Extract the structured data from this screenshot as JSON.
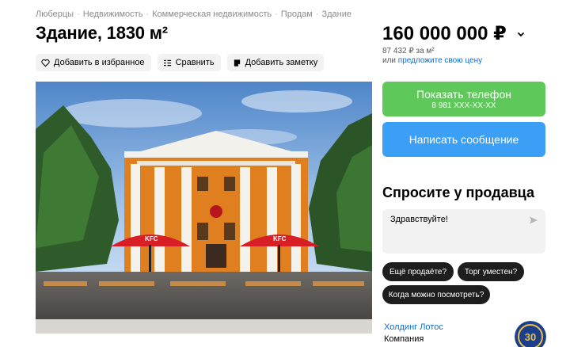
{
  "breadcrumb": {
    "items": [
      "Люберцы",
      "Недвижимость",
      "Коммерческая недвижимость",
      "Продам",
      "Здание"
    ]
  },
  "listing": {
    "title": "Здание, 1830 м²"
  },
  "actions": {
    "favorite": "Добавить в избранное",
    "compare": "Сравнить",
    "note": "Добавить заметку"
  },
  "photo": {
    "sign": "KFC"
  },
  "price": {
    "value": "160 000 000 ₽",
    "per_sqm": "87 432 ₽ за м²",
    "offer_prefix": "или",
    "offer_link": "предложите свою цену"
  },
  "contact": {
    "show_phone": "Показать телефон",
    "phone_masked": "8 981 XXX-XX-XX",
    "write_message": "Написать сообщение"
  },
  "ask": {
    "title": "Спросите у продавца",
    "message": "Здравствуйте!",
    "chips": [
      "Ещё продаёте?",
      "Торг уместен?",
      "Когда можно посмотреть?"
    ]
  },
  "seller": {
    "name": "Холдинг Лотос",
    "type": "Компания",
    "logo_badge": "30"
  },
  "colors": {
    "green": "#5ec95a",
    "blue": "#3ba0f5",
    "link": "#0a6bd9"
  }
}
